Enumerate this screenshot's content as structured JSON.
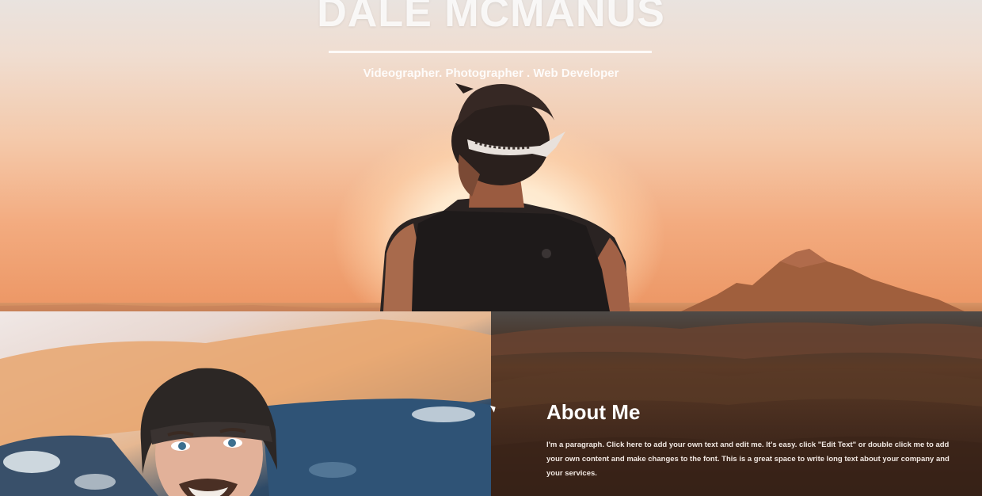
{
  "hero": {
    "title": "DALE MCMANUS",
    "subtitle": "Videographer. Photographer . Web Developer"
  },
  "about": {
    "heading": "About Me",
    "paragraph": "I'm a paragraph. Click here to add your own text and edit me. It's easy. click \"Edit Text\" or double click me to add your own content and make changes to the font. This is a great space to write long text about your company and your services."
  },
  "colors": {
    "sky_top": "#e9e3df",
    "sky_bottom": "#ec9664",
    "desert": "#5b3a26",
    "text_light": "#ffffff"
  }
}
